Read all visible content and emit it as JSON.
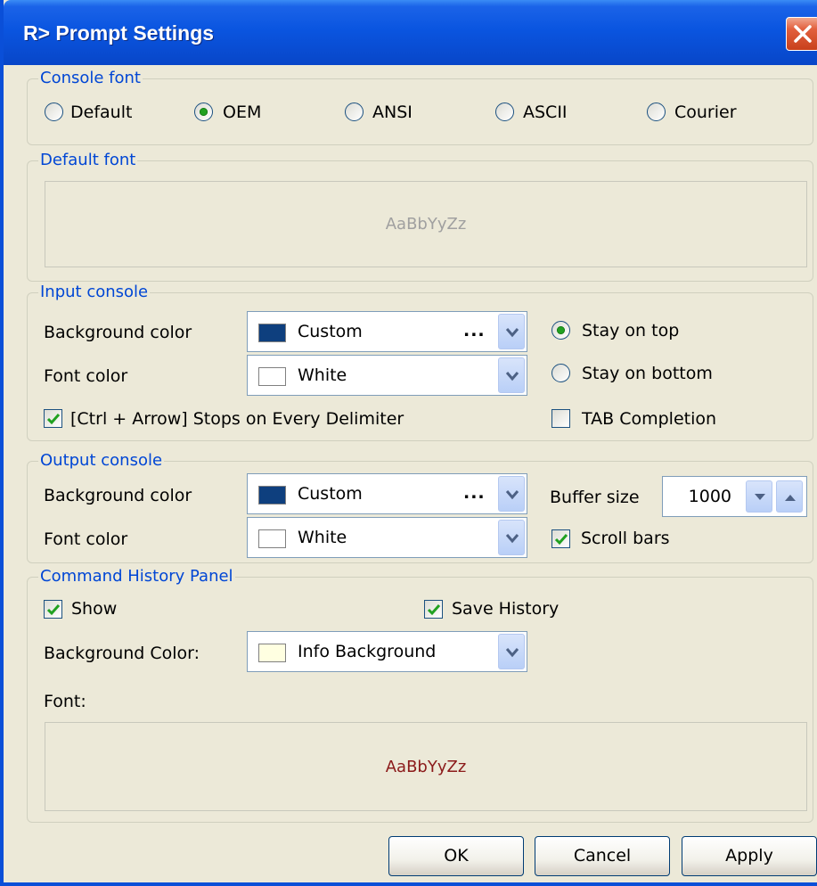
{
  "window": {
    "title": "R> Prompt Settings"
  },
  "console_font": {
    "legend": "Console font",
    "options": [
      "Default",
      "OEM",
      "ANSI",
      "ASCII",
      "Courier"
    ],
    "selected": "OEM"
  },
  "default_font": {
    "legend": "Default font",
    "sample": "AaBbYyZz"
  },
  "input_console": {
    "legend": "Input console",
    "bg_label": "Background color",
    "bg_value": "Custom",
    "bg_color": "#0e3f7e",
    "bg_ellipsis": "...",
    "font_label": "Font color",
    "font_value": "White",
    "font_color": "#ffffff",
    "stay_top": "Stay on top",
    "stay_bottom": "Stay on bottom",
    "stay_selected": "top",
    "ctrl_arrow": "[Ctrl + Arrow] Stops on Every Delimiter",
    "ctrl_arrow_checked": true,
    "tab_completion": "TAB Completion",
    "tab_completion_checked": false
  },
  "output_console": {
    "legend": "Output console",
    "bg_label": "Background color",
    "bg_value": "Custom",
    "bg_color": "#0e3f7e",
    "bg_ellipsis": "...",
    "font_label": "Font color",
    "font_value": "White",
    "font_color": "#ffffff",
    "buffer_label": "Buffer size",
    "buffer_value": "1000",
    "scroll_bars": "Scroll bars",
    "scroll_bars_checked": true
  },
  "history_panel": {
    "legend": "Command History Panel",
    "show": "Show",
    "show_checked": true,
    "save_history": "Save History",
    "save_history_checked": true,
    "bg_label": "Background Color:",
    "bg_value": "Info Background",
    "bg_color": "#ffffe1",
    "font_label": "Font:",
    "font_sample": "AaBbYyZz",
    "font_sample_color": "#8b1a1a"
  },
  "buttons": {
    "ok": "OK",
    "cancel": "Cancel",
    "apply": "Apply"
  },
  "colors": {
    "legend": "#0046d5",
    "title_bar": "#0a55e0",
    "close": "#d8502c",
    "check": "#21a121"
  }
}
